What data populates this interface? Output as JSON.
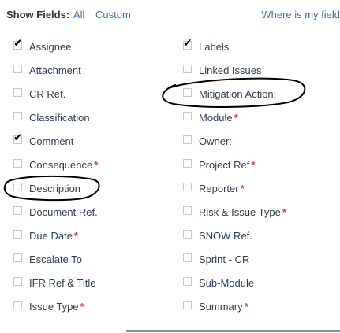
{
  "header": {
    "show_fields_label": "Show Fields:",
    "all_label": "All",
    "custom_label": "Custom",
    "where_label": "Where is my field"
  },
  "fields_left": [
    {
      "label": "Assignee",
      "checked": true,
      "required": false
    },
    {
      "label": "Attachment",
      "checked": false,
      "required": false
    },
    {
      "label": "CR Ref.",
      "checked": false,
      "required": false
    },
    {
      "label": "Classification",
      "checked": false,
      "required": false
    },
    {
      "label": "Comment",
      "checked": true,
      "required": false
    },
    {
      "label": "Consequence",
      "checked": false,
      "required": true
    },
    {
      "label": "Description",
      "checked": false,
      "required": false
    },
    {
      "label": "Document Ref.",
      "checked": false,
      "required": false
    },
    {
      "label": "Due Date",
      "checked": false,
      "required": true
    },
    {
      "label": "Escalate To",
      "checked": false,
      "required": false
    },
    {
      "label": "IFR Ref & Title",
      "checked": false,
      "required": false
    },
    {
      "label": "Issue Type",
      "checked": false,
      "required": true
    }
  ],
  "fields_right": [
    {
      "label": "Labels",
      "checked": true,
      "required": false
    },
    {
      "label": "Linked Issues",
      "checked": false,
      "required": false
    },
    {
      "label": "Mitigation Action:",
      "checked": false,
      "required": false
    },
    {
      "label": "Module",
      "checked": false,
      "required": true
    },
    {
      "label": "Owner:",
      "checked": false,
      "required": false
    },
    {
      "label": "Project Ref",
      "checked": false,
      "required": true
    },
    {
      "label": "Reporter",
      "checked": false,
      "required": true
    },
    {
      "label": "Risk & Issue Type",
      "checked": false,
      "required": true
    },
    {
      "label": "SNOW Ref.",
      "checked": false,
      "required": false
    },
    {
      "label": "Sprint - CR",
      "checked": false,
      "required": false
    },
    {
      "label": "Sub-Module",
      "checked": false,
      "required": false
    },
    {
      "label": "Summary",
      "checked": false,
      "required": true
    }
  ],
  "required_marker": "*",
  "check_glyph": "✔",
  "colors": {
    "link": "#3b73af",
    "required": "#d04437",
    "annotation": "#000000"
  }
}
